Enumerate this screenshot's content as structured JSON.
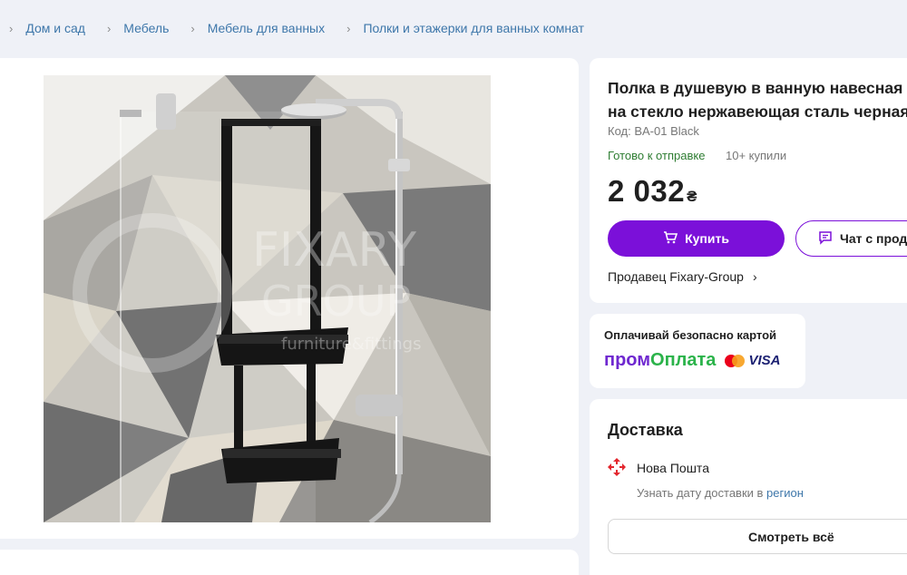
{
  "breadcrumb": [
    {
      "label": "Дом и сад"
    },
    {
      "label": "Мебель"
    },
    {
      "label": "Мебель для ванных"
    },
    {
      "label": "Полки и этажерки для ванных комнат"
    }
  ],
  "photo": {
    "watermark_line1": "FIXARY",
    "watermark_line2": "GROUP",
    "watermark_line3": "furniture&fittings"
  },
  "product": {
    "title_line1": "Полка в душевую в ванную навесная",
    "title_line2": "на стекло нержавеющая сталь черная",
    "code": "Код: BA-01 Black",
    "stock": "Готово к отправке",
    "bought": "10+ купили",
    "price": "2 032",
    "currency": "₴",
    "buy_label": "Купить",
    "chat_label": "Чат с продавцом",
    "seller": "Продавец Fixary-Group"
  },
  "payment": {
    "heading": "Оплачивай безопасно картой",
    "brand_part1": "пром",
    "brand_part2": "Оплата",
    "visa": "VISA"
  },
  "delivery": {
    "title": "Доставка",
    "carrier": "Нова Пошта",
    "hint": "Узнать дату доставки в",
    "hint_link": "регион",
    "see_all": "Смотреть всё"
  },
  "colors": {
    "accent": "#7b10d9",
    "link": "#3e77aa",
    "stock_green": "#2e7d32",
    "background": "#eff1f7"
  }
}
